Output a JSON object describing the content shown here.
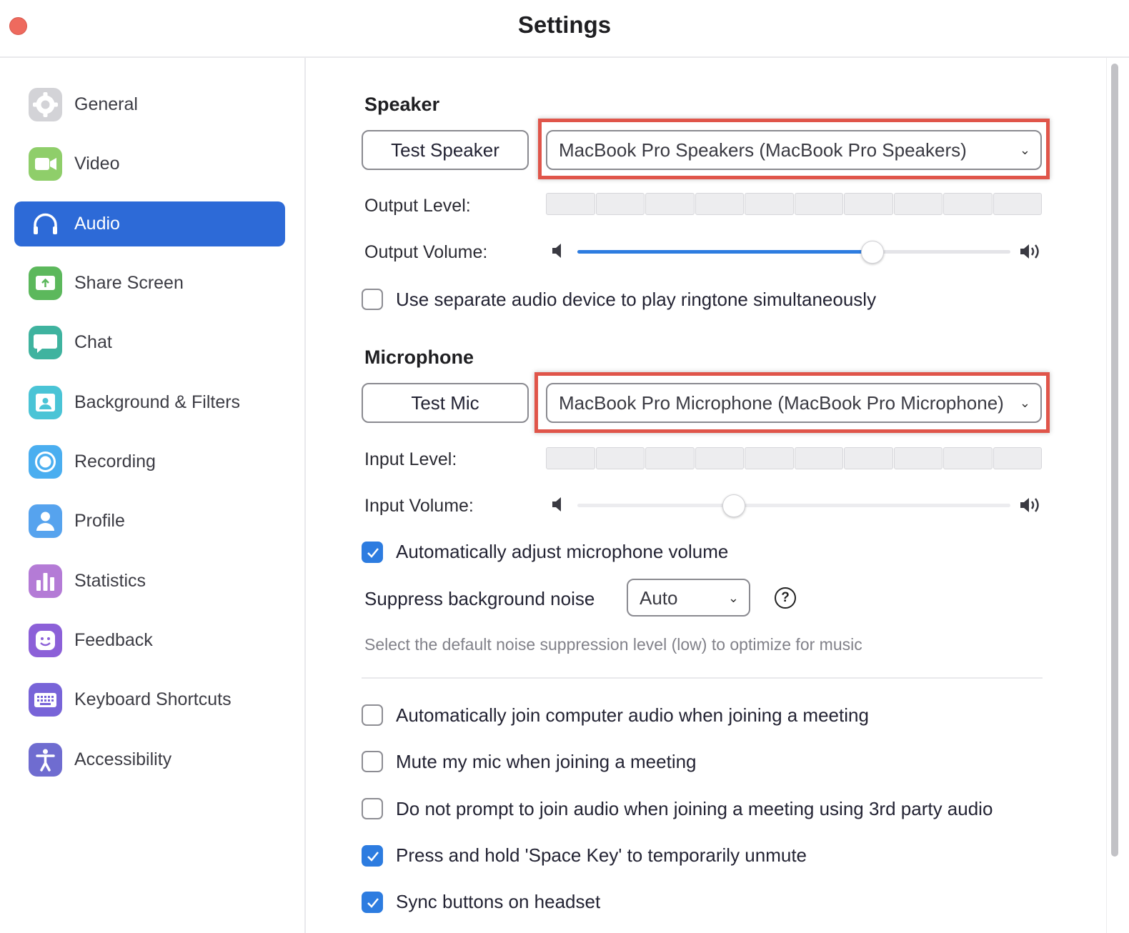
{
  "window": {
    "title": "Settings"
  },
  "sidebar": {
    "items": [
      {
        "label": "General",
        "icon": "gear-icon",
        "color": "#cfcfd3",
        "active": false
      },
      {
        "label": "Video",
        "icon": "video-camera-icon",
        "color": "#8fce6a",
        "active": false
      },
      {
        "label": "Audio",
        "icon": "headphones-icon",
        "color": "#2d6ad7",
        "active": true
      },
      {
        "label": "Share Screen",
        "icon": "share-screen-icon",
        "color": "#5cb85c",
        "active": false
      },
      {
        "label": "Chat",
        "icon": "chat-bubble-icon",
        "color": "#3fb39f",
        "active": false
      },
      {
        "label": "Background & Filters",
        "icon": "background-person-icon",
        "color": "#4ac4d6",
        "active": false
      },
      {
        "label": "Recording",
        "icon": "record-icon",
        "color": "#4aaef0",
        "active": false
      },
      {
        "label": "Profile",
        "icon": "profile-person-icon",
        "color": "#56a3ee",
        "active": false
      },
      {
        "label": "Statistics",
        "icon": "bar-chart-icon",
        "color": "#b47bd6",
        "active": false
      },
      {
        "label": "Feedback",
        "icon": "smiley-icon",
        "color": "#8c60d8",
        "active": false
      },
      {
        "label": "Keyboard Shortcuts",
        "icon": "keyboard-icon",
        "color": "#7864d8",
        "active": false
      },
      {
        "label": "Accessibility",
        "icon": "accessibility-person-icon",
        "color": "#6f6cd0",
        "active": false
      }
    ]
  },
  "speaker": {
    "title": "Speaker",
    "test_button": "Test Speaker",
    "device": "MacBook Pro Speakers (MacBook Pro Speakers)",
    "output_level_label": "Output Level:",
    "output_level_segments": 10,
    "output_volume_label": "Output Volume:",
    "output_volume_percent": 68,
    "separate_device_label": "Use separate audio device to play ringtone simultaneously",
    "separate_device_checked": false
  },
  "microphone": {
    "title": "Microphone",
    "test_button": "Test Mic",
    "device": "MacBook Pro Microphone (MacBook Pro Microphone)",
    "input_level_label": "Input Level:",
    "input_volume_label": "Input Volume:",
    "input_volume_percent": 36,
    "auto_adjust_label": "Automatically adjust microphone volume",
    "auto_adjust_checked": true,
    "suppress_label": "Suppress background noise",
    "suppress_value": "Auto",
    "suppress_hint": "Select the default noise suppression level (low) to optimize for music"
  },
  "options": [
    {
      "label": "Automatically join computer audio when joining a meeting",
      "checked": false
    },
    {
      "label": "Mute my mic when joining a meeting",
      "checked": false
    },
    {
      "label": "Do not prompt to join audio when joining a meeting using 3rd party audio",
      "checked": false
    },
    {
      "label": "Press and hold 'Space Key' to temporarily unmute",
      "checked": true
    },
    {
      "label": "Sync buttons on headset",
      "checked": true
    }
  ],
  "colors": {
    "accent": "#2d7ce0",
    "highlight": "#e0554a",
    "sidebar_active": "#2d6ad7"
  }
}
